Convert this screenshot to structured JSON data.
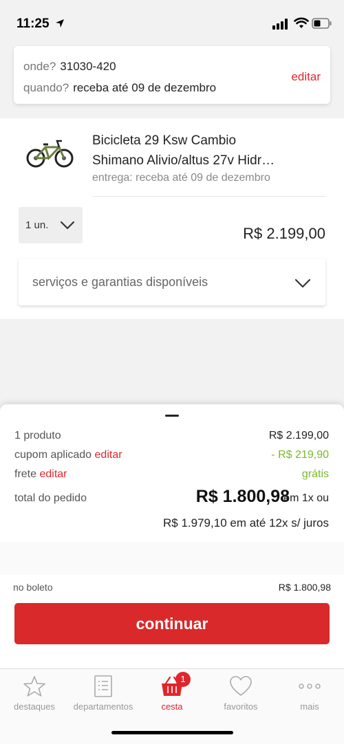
{
  "status_bar": {
    "time": "11:25"
  },
  "delivery": {
    "where_label": "onde?",
    "where_value": "31030-420",
    "when_label": "quando?",
    "when_value": "receba até 09 de dezembro",
    "edit_label": "editar"
  },
  "product": {
    "title_line1": "Bicicleta 29 Ksw Cambio",
    "title_line2": "Shimano Alivio/altus 27v Hidr…",
    "delivery_text": "entrega: receba até 09 de dezembro",
    "quantity": "1 un.",
    "price": "R$ 2.199,00",
    "services_label": "serviços e garantias disponíveis"
  },
  "summary": {
    "products_label": "1 produto",
    "products_value": "R$ 2.199,00",
    "coupon_label": "cupom aplicado",
    "coupon_edit": "editar",
    "coupon_value": "- R$ 219,90",
    "shipping_label": "frete",
    "shipping_edit": "editar",
    "shipping_value": "grátis",
    "total_label": "total do pedido",
    "total_value": "R$ 1.800,98",
    "total_suffix": "em 1x ou",
    "installments": "R$ 1.979,10 em até 12x s/ juros",
    "boleto_label": "no boleto",
    "boleto_value": "R$ 1.800,98",
    "continue_label": "continuar"
  },
  "tabs": [
    {
      "label": "destaques",
      "icon": "star-icon"
    },
    {
      "label": "departamentos",
      "icon": "list-icon"
    },
    {
      "label": "cesta",
      "icon": "basket-icon",
      "badge": "1",
      "active": true
    },
    {
      "label": "favoritos",
      "icon": "heart-icon"
    },
    {
      "label": "mais",
      "icon": "more-icon"
    }
  ],
  "colors": {
    "accent": "#e0262c",
    "button": "#d9292a",
    "discount": "#7ab829"
  }
}
